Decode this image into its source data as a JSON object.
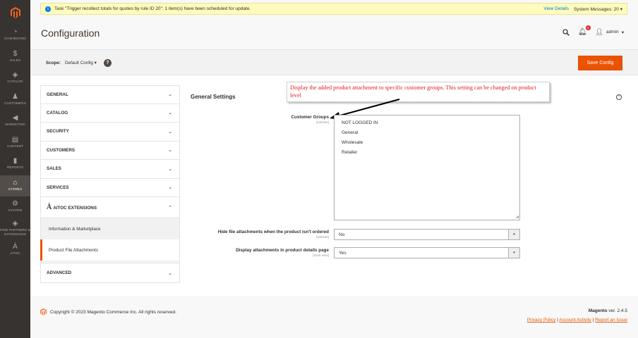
{
  "nav": {
    "items": [
      {
        "label": "DASHBOARD",
        "icon": "speedometer-icon",
        "glyph": "◔"
      },
      {
        "label": "SALES",
        "icon": "dollar-icon",
        "glyph": "$"
      },
      {
        "label": "CATALOG",
        "icon": "cube-icon",
        "glyph": "◈"
      },
      {
        "label": "CUSTOMERS",
        "icon": "person-icon",
        "glyph": "♟"
      },
      {
        "label": "MARKETING",
        "icon": "megaphone-icon",
        "glyph": "◀"
      },
      {
        "label": "CONTENT",
        "icon": "layout-icon",
        "glyph": "▤"
      },
      {
        "label": "REPORTS",
        "icon": "bar-chart-icon",
        "glyph": "▮"
      },
      {
        "label": "STORES",
        "icon": "store-icon",
        "glyph": "⌂"
      },
      {
        "label": "SYSTEM",
        "icon": "gear-icon",
        "glyph": "⚙"
      },
      {
        "label": "FIND PARTNERS & EXTENSIONS",
        "icon": "cube-extension-icon",
        "glyph": "◈"
      },
      {
        "label": "AITOC",
        "icon": "aitoc-logo-icon",
        "glyph": "Ȧ"
      }
    ]
  },
  "notice": {
    "message": "Task \"Trigger recollect totals for quotes by rule ID 20\": 1 item(s) have been scheduled for update.",
    "view_details": "View Details",
    "system_messages": "System Messages: 20"
  },
  "header": {
    "title": "Configuration",
    "notification_count": "8",
    "user": "admin"
  },
  "scope": {
    "label": "Scope:",
    "value": "Default Config",
    "save_label": "Save Config"
  },
  "tabs": {
    "general": "GENERAL",
    "catalog": "CATALOG",
    "security": "SECURITY",
    "customers": "CUSTOMERS",
    "sales": "SALES",
    "services": "SERVICES",
    "aitoc": "AITOC EXTENSIONS",
    "aitoc_info": "Information & Marketplace",
    "aitoc_attachments": "Product File Attachments",
    "advanced": "ADVANCED"
  },
  "section": {
    "title": "General Settings"
  },
  "annotation": "Display the added product attachment to specific customer groups. This setting can be changed on product level",
  "fields": {
    "customer_groups": {
      "label": "Customer Groups",
      "scope": "[website]",
      "options": [
        "NOT LOGGED IN",
        "General",
        "Wholesale",
        "Retailer"
      ]
    },
    "hide_attachments": {
      "label": "Hide file attachments when the product isn't ordered",
      "scope": "[website]",
      "value": "No"
    },
    "display_attachments": {
      "label": "Display attachments in product details page",
      "scope": "[store view]",
      "value": "Yes"
    }
  },
  "footer": {
    "copyright": "Copyright © 2023 Magento Commerce Inc. All rights reserved.",
    "brand": "Magento",
    "version": "ver. 2.4.5",
    "privacy": "Privacy Policy",
    "activity": "Account Activity",
    "report": "Report an Issue"
  },
  "colors": {
    "accent": "#eb5202",
    "nav_bg": "#373330",
    "link": "#007bdb",
    "annotation": "#e31c1c"
  }
}
